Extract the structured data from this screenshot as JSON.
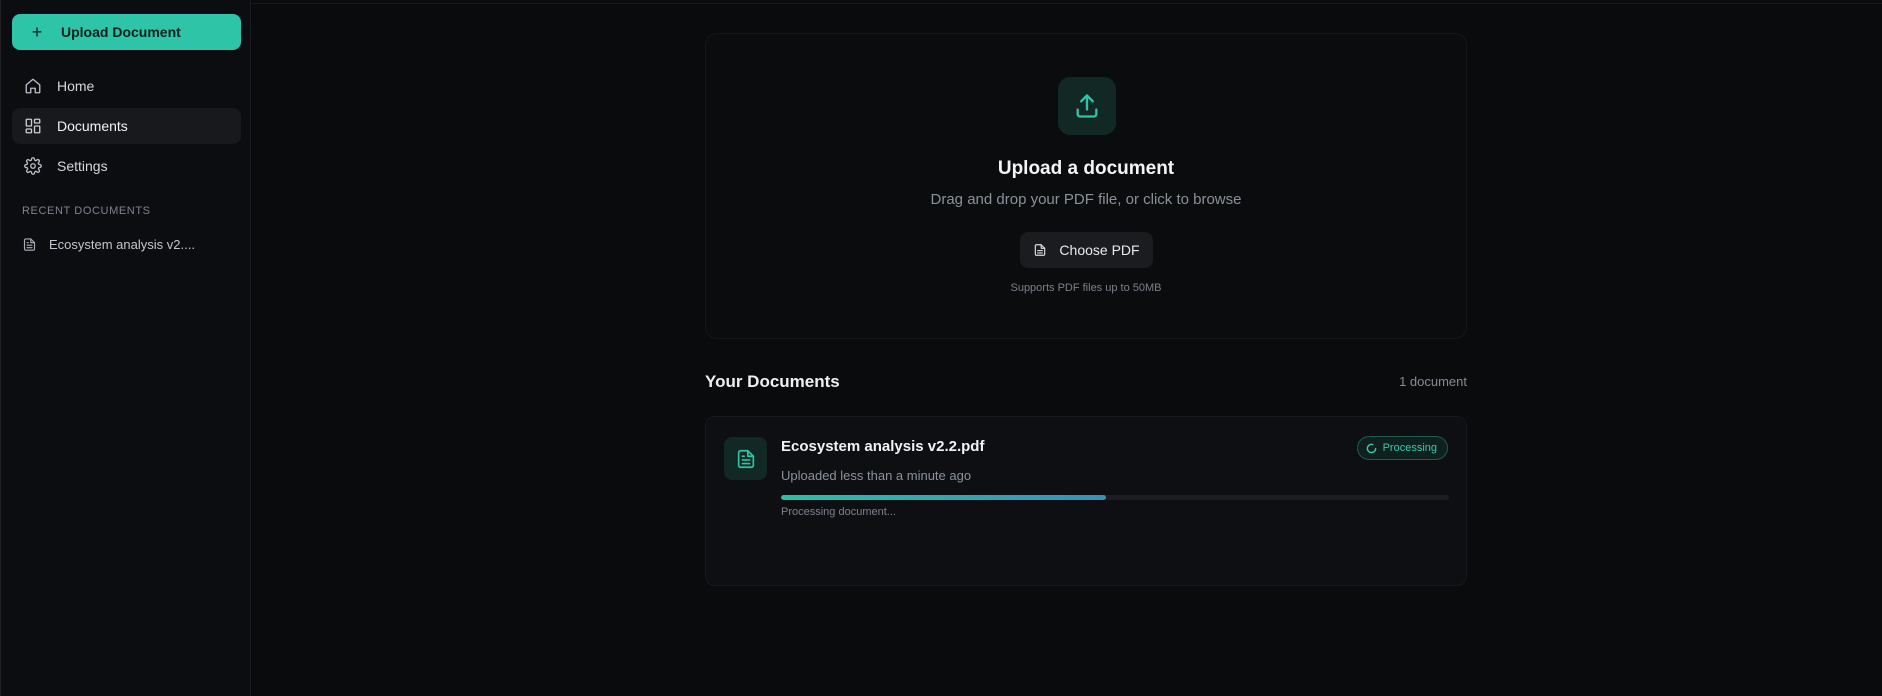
{
  "colors": {
    "accent": "#2ec4a8",
    "background": "#0a0b0d",
    "sidebar": "#0c0d10",
    "status_processing": "#38c9ad"
  },
  "sidebar": {
    "upload_button": {
      "label": "Upload Document",
      "icon": "plus-icon"
    },
    "nav": [
      {
        "label": "Home",
        "icon": "home-icon",
        "active": false
      },
      {
        "label": "Documents",
        "icon": "grid-icon",
        "active": true
      },
      {
        "label": "Settings",
        "icon": "gear-icon",
        "active": false
      }
    ],
    "recent_label": "RECENT DOCUMENTS",
    "recent": [
      {
        "label": "Ecosystem analysis v2....",
        "icon": "file-icon"
      }
    ]
  },
  "upload": {
    "icon": "upload-icon",
    "title": "Upload a document",
    "subtitle": "Drag and drop your PDF file, or click to browse",
    "button_label": "Choose PDF",
    "note": "Supports PDF files up to 50MB"
  },
  "documents": {
    "title": "Your Documents",
    "count": "1 document",
    "items": [
      {
        "name": "Ecosystem analysis v2.2.pdf",
        "meta": "Uploaded less than a minute ago",
        "status": "Processing",
        "progress": 0.486,
        "progress_label": "Processing document..."
      }
    ]
  }
}
